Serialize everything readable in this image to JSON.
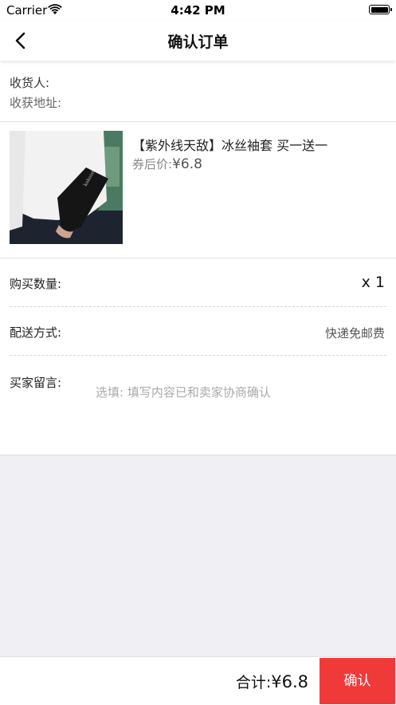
{
  "status_bar": {
    "carrier": "Carrier",
    "time": "4:42 PM"
  },
  "nav": {
    "title": "确认订单"
  },
  "address": {
    "receiver_label": "收货人:",
    "address_label": "收获地址:"
  },
  "product": {
    "title": "【紫外线天敌】冰丝袖套 买一送一",
    "price_label": "券后价:",
    "price": "¥6.8",
    "image_text": "kokoist"
  },
  "quantity": {
    "label": "购买数量:",
    "value": "x 1"
  },
  "shipping": {
    "label": "配送方式:",
    "value": "快递免邮费"
  },
  "message": {
    "label": "买家留言:",
    "placeholder": "选填: 填写内容已和卖家协商确认"
  },
  "footer": {
    "total_label": "合计:",
    "total_value": "¥6.8",
    "confirm_label": "确认"
  },
  "colors": {
    "accent": "#f03a3a",
    "background": "#efeff4"
  }
}
